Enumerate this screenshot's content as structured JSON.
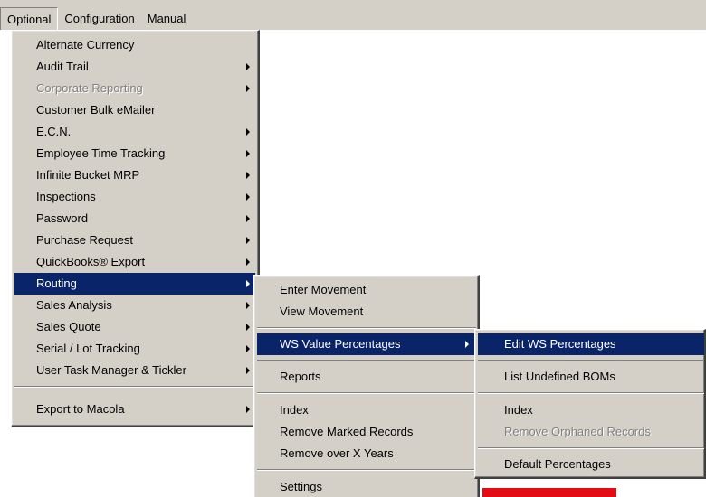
{
  "menubar": {
    "items": [
      "Optional",
      "Configuration",
      "Manual"
    ]
  },
  "main_menu": {
    "items": [
      {
        "label": "Alternate Currency",
        "submenu": false
      },
      {
        "label": "Audit Trail",
        "submenu": true
      },
      {
        "label": "Corporate Reporting",
        "submenu": true,
        "disabled": true
      },
      {
        "label": "Customer Bulk eMailer",
        "submenu": false
      },
      {
        "label": "E.C.N.",
        "submenu": true
      },
      {
        "label": "Employee Time Tracking",
        "submenu": true
      },
      {
        "label": "Infinite Bucket MRP",
        "submenu": true
      },
      {
        "label": "Inspections",
        "submenu": true
      },
      {
        "label": "Password",
        "submenu": true
      },
      {
        "label": "Purchase Request",
        "submenu": true
      },
      {
        "label": "QuickBooks® Export",
        "submenu": true
      },
      {
        "label": "Routing",
        "submenu": true,
        "selected": true
      },
      {
        "label": "Sales Analysis",
        "submenu": true
      },
      {
        "label": "Sales Quote",
        "submenu": true
      },
      {
        "label": "Serial / Lot Tracking",
        "submenu": true
      },
      {
        "label": "User Task Manager & Tickler",
        "submenu": true
      },
      {
        "label": "Export to Macola",
        "submenu": true
      }
    ]
  },
  "routing_menu": {
    "items": [
      {
        "label": "Enter Movement"
      },
      {
        "label": "View Movement"
      },
      {
        "label": "WS Value Percentages",
        "submenu": true,
        "selected": true
      },
      {
        "label": "Reports"
      },
      {
        "label": "Index"
      },
      {
        "label": "Remove Marked Records"
      },
      {
        "label": "Remove over X Years"
      },
      {
        "label": "Settings"
      }
    ]
  },
  "ws_menu": {
    "items": [
      {
        "label": "Edit WS Percentages",
        "selected": true
      },
      {
        "label": "List Undefined BOMs"
      },
      {
        "label": "Index"
      },
      {
        "label": "Remove Orphaned Records",
        "disabled": true
      },
      {
        "label": "Default Percentages"
      }
    ]
  },
  "colors": {
    "menu_bg": "#d4d0c8",
    "highlight": "#0a246a",
    "accent_red": "#e30b14"
  }
}
